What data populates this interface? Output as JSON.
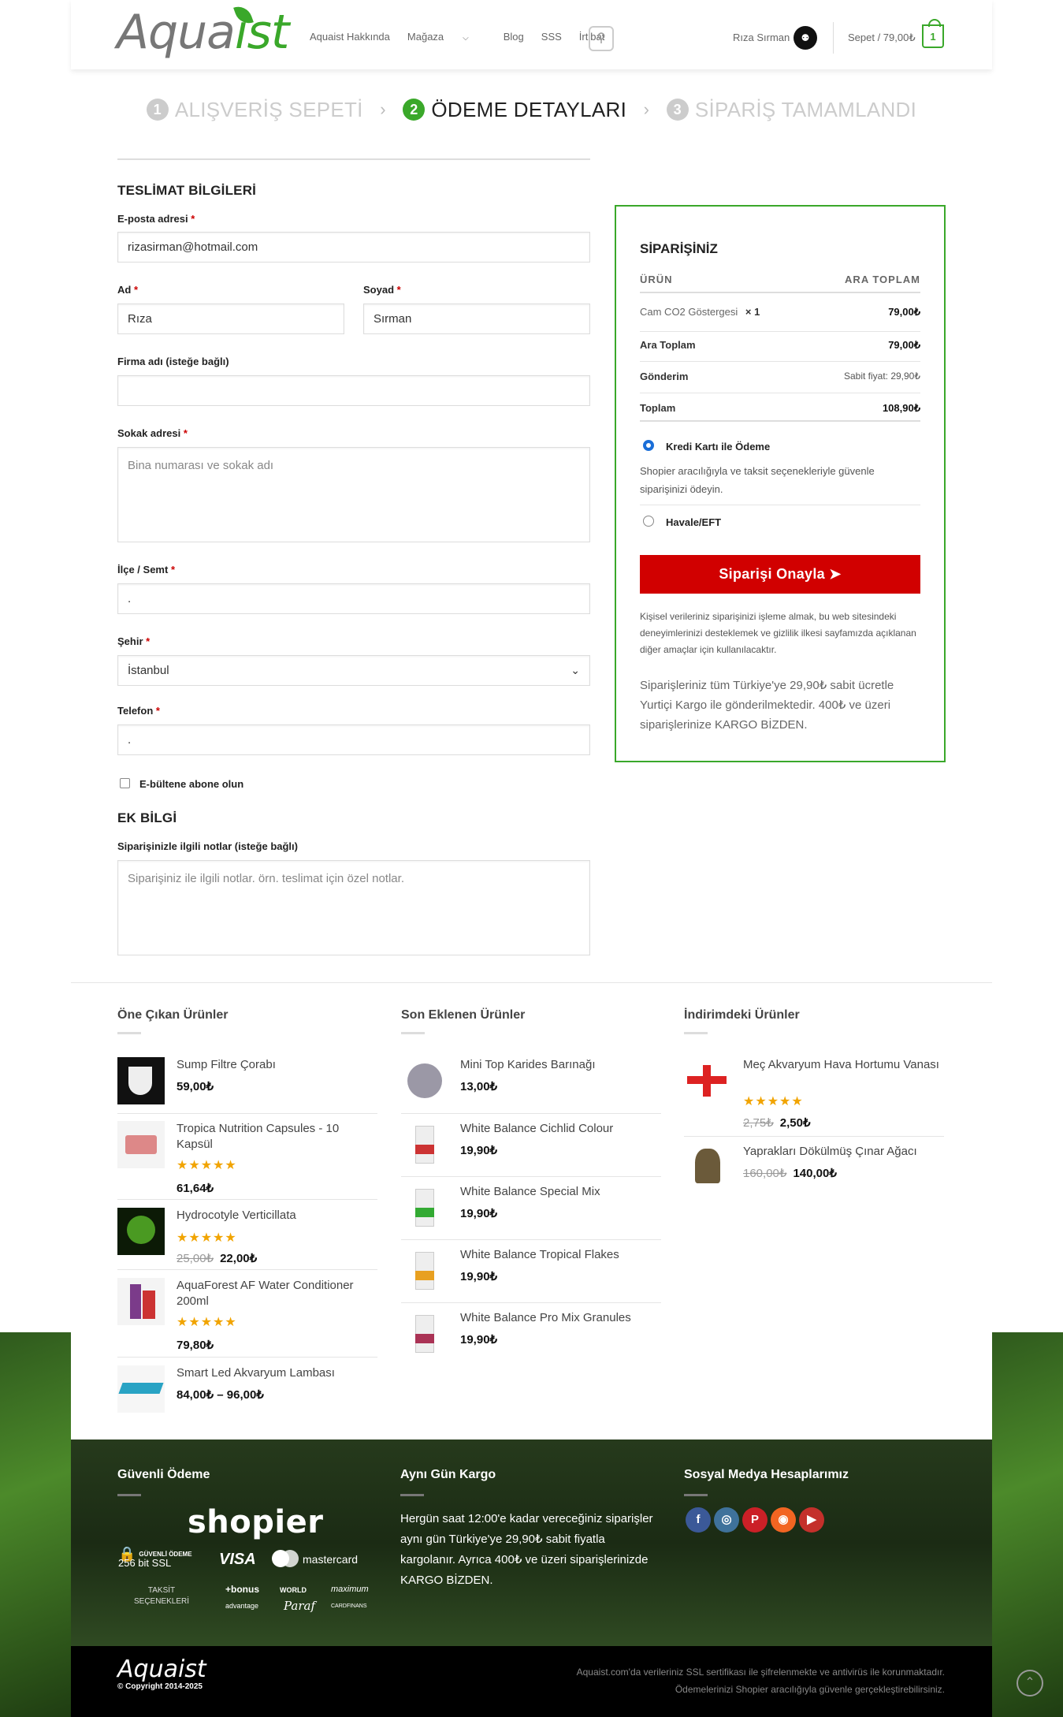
{
  "header": {
    "logo_main": "Aqua",
    "logo_accent": "ist",
    "nav": [
      "Aquaist Hakkında",
      "Mağaza",
      "Blog",
      "SSS",
      "İrtibat"
    ],
    "user_name": "Rıza Sırman",
    "cart_label": "Sepet / 79,00₺",
    "cart_count": "1"
  },
  "steps": [
    {
      "num": "1",
      "label": "ALIŞVERİŞ SEPETİ"
    },
    {
      "num": "2",
      "label": "ÖDEME DETAYLARI"
    },
    {
      "num": "3",
      "label": "SİPARİŞ TAMAMLANDI"
    }
  ],
  "billing": {
    "title": "TESLİMAT BİLGİLERİ",
    "email_label": "E-posta adresi",
    "email_value": "rizasirman@hotmail.com",
    "first_label": "Ad",
    "first_value": "Rıza",
    "last_label": "Soyad",
    "last_value": "Sırman",
    "company_label": "Firma adı (isteğe bağlı)",
    "street_label": "Sokak adresi",
    "street_placeholder": "Bina numarası ve sokak adı",
    "district_label": "İlçe / Semt",
    "district_value": ".",
    "city_label": "Şehir",
    "city_value": "İstanbul",
    "phone_label": "Telefon",
    "phone_value": ".",
    "newsletter_label": "E-bültene abone olun",
    "required_mark": "*"
  },
  "extra": {
    "title": "EK BİLGİ",
    "notes_label": "Siparişinizle ilgili notlar (isteğe bağlı)",
    "notes_placeholder": "Siparişiniz ile ilgili notlar. örn. teslimat için özel notlar."
  },
  "order": {
    "title": "SİPARİŞİNİZ",
    "col_product": "ÜRÜN",
    "col_subtotal": "ARA TOPLAM",
    "item_name": "Cam CO2 Göstergesi",
    "item_qty": "× 1",
    "item_price": "79,00₺",
    "subtotal_label": "Ara Toplam",
    "subtotal_value": "79,00₺",
    "shipping_label": "Gönderim",
    "shipping_value": "Sabit fiyat:  29,90₺",
    "total_label": "Toplam",
    "total_value": "108,90₺",
    "pay_card_label": "Kredi Kartı ile Ödeme",
    "pay_card_desc": "Shopier aracılığıyla ve taksit seçenekleriyle güvenle siparişinizi ödeyin.",
    "pay_eft_label": "Havale/EFT",
    "confirm_label": "Siparişi Onayla ➤",
    "privacy": "Kişisel verileriniz siparişinizi işleme almak, bu web sitesindeki deneyimlerinizi desteklemek ve gizlilik ilkesi sayfamızda açıklanan diğer amaçlar için kullanılacaktır.",
    "shipping_note": "Siparişleriniz tüm Türkiye'ye 29,90₺ sabit ücretle Yurtiçi Kargo ile gönderilmektedir. 400₺ ve üzeri siparişlerinize KARGO BİZDEN."
  },
  "widgets": {
    "featured_title": "Öne Çıkan Ürünler",
    "latest_title": "Son Eklenen Ürünler",
    "sale_title": "İndirimdeki Ürünler",
    "stars": "★★★★★",
    "featured": [
      {
        "name": "Sump Filtre Çorabı",
        "price": "59,00₺",
        "old": ""
      },
      {
        "name": "Tropica Nutrition Capsules - 10 Kapsül",
        "price": "61,64₺",
        "old": ""
      },
      {
        "name": "Hydrocotyle Verticillata",
        "price": "22,00₺",
        "old": "25,00₺"
      },
      {
        "name": "AquaForest AF Water Conditioner 200ml",
        "price": "79,80₺",
        "old": ""
      },
      {
        "name": "Smart Led Akvaryum Lambası",
        "price": "84,00₺ – 96,00₺",
        "old": ""
      }
    ],
    "latest": [
      {
        "name": "Mini Top Karides Barınağı",
        "price": "13,00₺"
      },
      {
        "name": "White Balance Cichlid Colour",
        "price": "19,90₺"
      },
      {
        "name": "White Balance Special Mix",
        "price": "19,90₺"
      },
      {
        "name": "White Balance Tropical Flakes",
        "price": "19,90₺"
      },
      {
        "name": "White Balance Pro Mix Granules",
        "price": "19,90₺"
      }
    ],
    "sale": [
      {
        "name": "Meç Akvaryum Hava Hortumu Vanası",
        "price": "2,50₺",
        "old": "2,75₺"
      },
      {
        "name": "Yaprakları Dökülmüş Çınar Ağacı",
        "price": "140,00₺",
        "old": "160,00₺"
      }
    ]
  },
  "footer": {
    "secure_title": "Güvenli Ödeme",
    "cargo_title": "Aynı Gün Kargo",
    "social_title": "Sosyal Medya Hesaplarımız",
    "shopier": "shopier",
    "ssl_line1": "GÜVENLİ ÖDEME",
    "ssl_line2": "256 bit SSL",
    "visa": "VISA",
    "mastercard": "mastercard",
    "taksit": "TAKSİT SEÇENEKLERİ",
    "cards": [
      "+bonus",
      "WORLD",
      "maximum",
      "advantage",
      "Paraf",
      "CARDFINANS"
    ],
    "cargo_text": "Hergün saat 12:00'e kadar vereceğiniz siparişler aynı gün Türkiye'ye 29,90₺ sabit fiyatla kargolanır. Ayrıca 400₺ ve üzeri siparişlerinizde KARGO BİZDEN.",
    "social": [
      {
        "icon": "facebook-icon",
        "glyph": "f",
        "color": "#3b5998"
      },
      {
        "icon": "instagram-icon",
        "glyph": "◎",
        "color": "#3f729b"
      },
      {
        "icon": "pinterest-icon",
        "glyph": "P",
        "color": "#cb2027"
      },
      {
        "icon": "rss-icon",
        "glyph": "◉",
        "color": "#f26522"
      },
      {
        "icon": "youtube-icon",
        "glyph": "▶",
        "color": "#c4302b"
      }
    ],
    "bottom_logo": "Aquaist",
    "copyright": "© Copyright 2014-2025",
    "bottom_line1": "Aquaist.com'da verileriniz SSL sertifikası ile şifrelenmekte ve antivirüs ile korunmaktadır.",
    "bottom_line2": "Ödemelerinizi Shopier aracılığıyla güvenle gerçekleştirebilirsiniz."
  }
}
